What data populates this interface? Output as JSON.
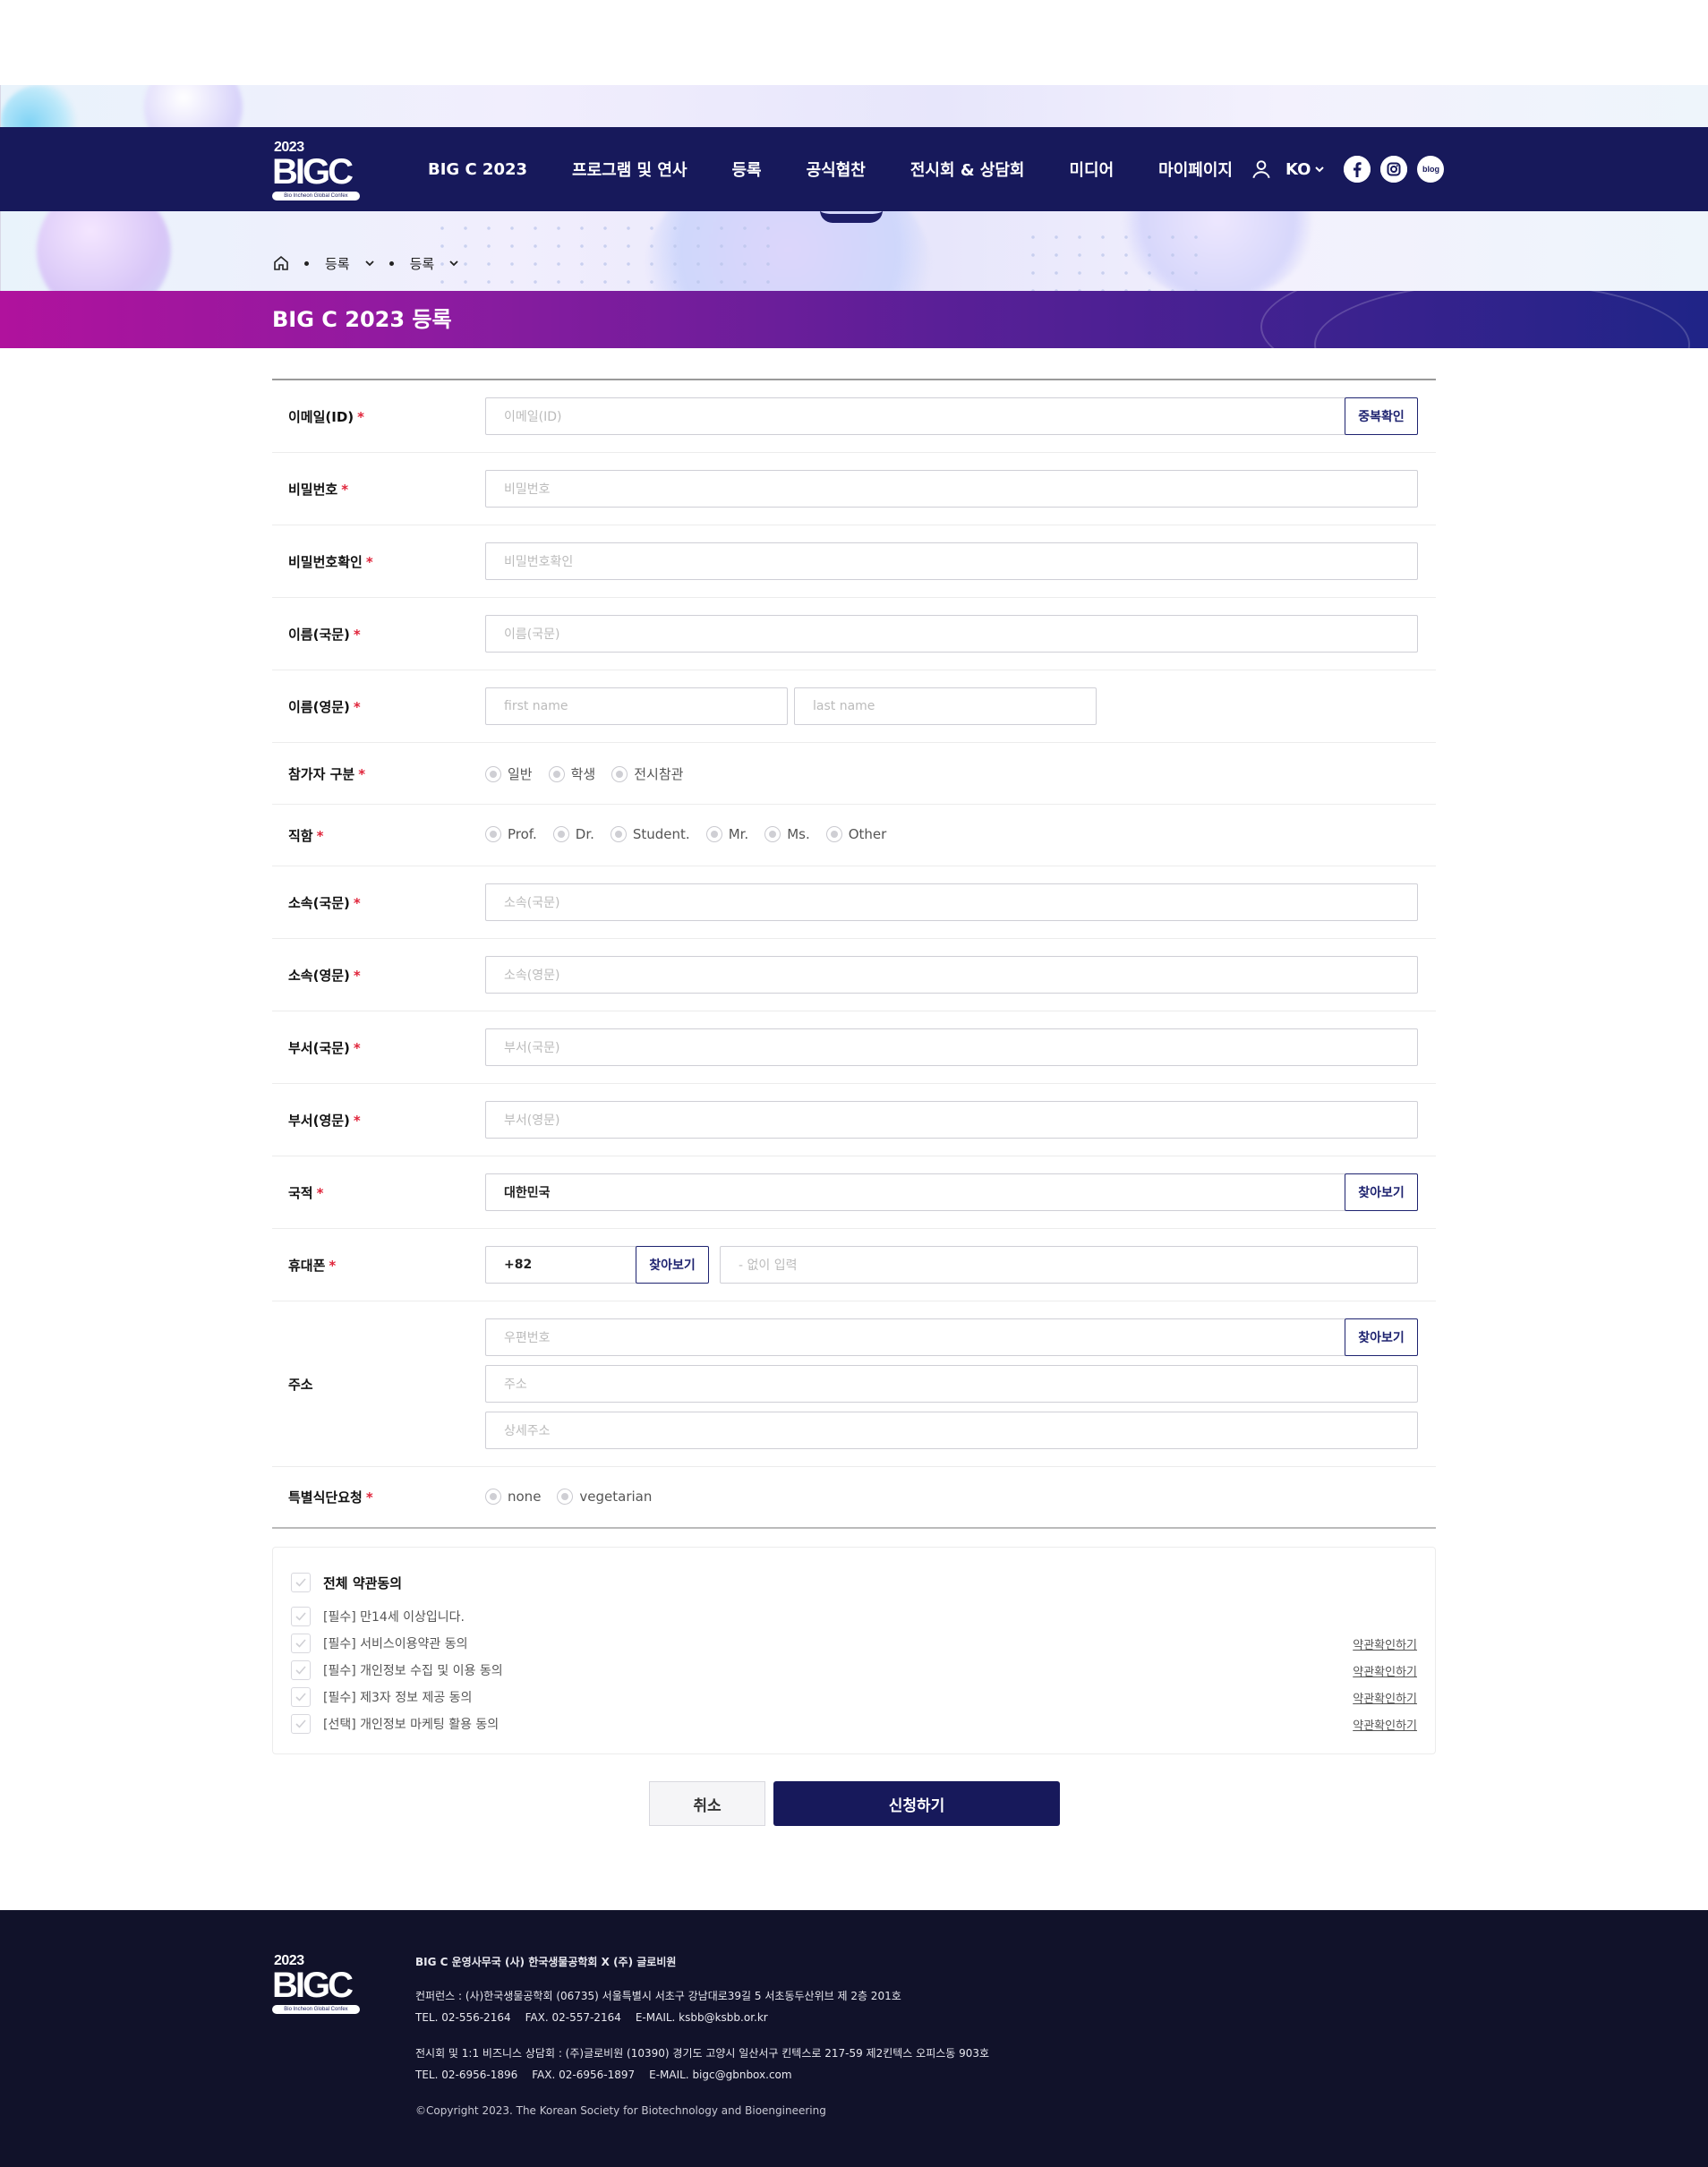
{
  "brand": {
    "year": "2023",
    "wordmark": "BIGC",
    "tagline": "Bio Incheon Global Confex"
  },
  "nav": {
    "items": [
      "BIG C 2023",
      "프로그램 및 연사",
      "등록",
      "공식협찬",
      "전시회 & 상담회",
      "미디어",
      "마이페이지"
    ],
    "lang": "KO",
    "blog_label": "blog"
  },
  "breadcrumb": {
    "items": [
      "등록",
      "등록"
    ]
  },
  "page": {
    "title": "BIG C 2023 등록"
  },
  "form": {
    "email": {
      "label": "이메일(ID)",
      "placeholder": "이메일(ID)",
      "button": "중복확인"
    },
    "password": {
      "label": "비밀번호",
      "placeholder": "비밀번호"
    },
    "password_confirm": {
      "label": "비밀번호확인",
      "placeholder": "비밀번호확인"
    },
    "name_kr": {
      "label": "이름(국문)",
      "placeholder": "이름(국문)"
    },
    "name_en": {
      "label": "이름(영문)",
      "first_placeholder": "first name",
      "last_placeholder": "last name"
    },
    "participant_type": {
      "label": "참가자 구분",
      "options": [
        "일반",
        "학생",
        "전시참관"
      ]
    },
    "title": {
      "label": "직함",
      "options": [
        "Prof.",
        "Dr.",
        "Student.",
        "Mr.",
        "Ms.",
        "Other"
      ]
    },
    "affiliation_kr": {
      "label": "소속(국문)",
      "placeholder": "소속(국문)"
    },
    "affiliation_en": {
      "label": "소속(영문)",
      "placeholder": "소속(영문)"
    },
    "dept_kr": {
      "label": "부서(국문)",
      "placeholder": "부서(국문)"
    },
    "dept_en": {
      "label": "부서(영문)",
      "placeholder": "부서(영문)"
    },
    "nationality": {
      "label": "국적",
      "value": "대한민국",
      "button": "찾아보기"
    },
    "phone": {
      "label": "휴대폰",
      "code": "+82",
      "button": "찾아보기",
      "placeholder": "- 없이 입력"
    },
    "address": {
      "label": "주소",
      "zip_placeholder": "우편번호",
      "button": "찾아보기",
      "addr_placeholder": "주소",
      "detail_placeholder": "상세주소"
    },
    "diet": {
      "label": "특별식단요청",
      "options": [
        "none",
        "vegetarian"
      ]
    },
    "required_mark": "*"
  },
  "agreements": {
    "all": "전체 약관동의",
    "items": [
      {
        "text": "[필수] 만14세 이상입니다.",
        "link": ""
      },
      {
        "text": "[필수] 서비스이용약관 동의",
        "link": "약관확인하기"
      },
      {
        "text": "[필수] 개인정보 수집 및 이용 동의",
        "link": "약관확인하기"
      },
      {
        "text": "[필수] 제3자 정보 제공 동의",
        "link": "약관확인하기"
      },
      {
        "text": "[선택] 개인정보 마케팅 활용 동의",
        "link": "약관확인하기"
      }
    ]
  },
  "actions": {
    "cancel": "취소",
    "submit": "신청하기"
  },
  "footer": {
    "org": "BIG C 운영사무국 (사) 한국생물공학회 X (주) 글로비원",
    "conf_address": "컨퍼런스 : (사)한국생물공학회 (06735) 서울특별시 서초구 강남대로39길 5 서초동두산위브 제 2층 201호",
    "conf_tel": "TEL. 02-556-2164",
    "conf_fax": "FAX. 02-557-2164",
    "conf_email": "E-MAIL. ksbb@ksbb.or.kr",
    "expo_address": "전시회 및 1:1 비즈니스 상담회 : (주)글로비원 (10390) 경기도 고양시 일산서구 킨텍스로 217-59 제2킨텍스 오피스동 903호",
    "expo_tel": "TEL. 02-6956-1896",
    "expo_fax": "FAX. 02-6956-1897",
    "expo_email": "E-MAIL. bigc@gbnbox.com",
    "copyright": "©Copyright 2023. The Korean Society for Biotechnology and Bioengineering"
  },
  "colors": {
    "navy": "#17195b",
    "required": "#e0243a",
    "title_band_start": "#b0129d",
    "title_band_end": "#1f2487",
    "footer_bg": "#11122a"
  }
}
